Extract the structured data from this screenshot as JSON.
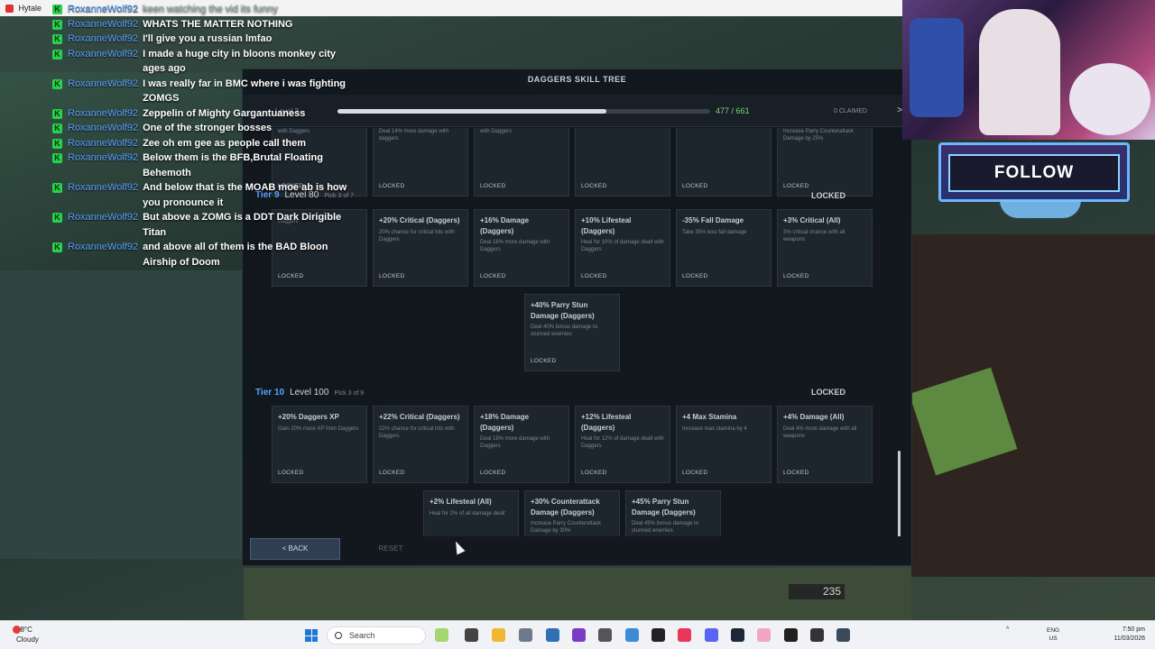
{
  "app_title": "Hytale",
  "chat": [
    {
      "user": "RoxanneWolf92",
      "msg": "keen watching the vid its funny"
    },
    {
      "user": "RoxanneWolf92",
      "msg": "WHATS THE MATTER NOTHING"
    },
    {
      "user": "RoxanneWolf92",
      "msg": "I'll give you a russian lmfao"
    },
    {
      "user": "RoxanneWolf92",
      "msg": "I made a huge city in bloons monkey city ages ago"
    },
    {
      "user": "RoxanneWolf92",
      "msg": "I was really far in BMC where i was fighting ZOMGS"
    },
    {
      "user": "RoxanneWolf92",
      "msg": "Zeppelin of Mighty Gargantuaness"
    },
    {
      "user": "RoxanneWolf92",
      "msg": "One of the stronger bosses"
    },
    {
      "user": "RoxanneWolf92",
      "msg": "Zee oh em gee as people call them"
    },
    {
      "user": "RoxanneWolf92",
      "msg": "Below them is the BFB,Brutal Floating Behemoth"
    },
    {
      "user": "RoxanneWolf92",
      "msg": "And below that is the MOAB moe ab is how you pronounce it"
    },
    {
      "user": "RoxanneWolf92",
      "msg": "But above a ZOMG is a DDT Dark Dirigible Titan"
    },
    {
      "user": "",
      "msg": "and above all of them is the BAD Bloon Airship of Doom"
    }
  ],
  "panel": {
    "title": "DAGGERS SKILL TREE",
    "level": "Level 2",
    "progress_text": "477 / 661",
    "progress_fraction": 0.722,
    "claimed": "0 CLAIMED",
    "next": ">",
    "back": "< BACK",
    "reset": "RESET"
  },
  "top_row": [
    {
      "title": "",
      "desc": "with Daggers",
      "status": "LOCKED"
    },
    {
      "title": "",
      "desc": "Deal 14% more damage with daggers",
      "status": "LOCKED"
    },
    {
      "title": "",
      "desc": "with Daggers",
      "status": "LOCKED"
    },
    {
      "title": "",
      "desc": "",
      "status": "LOCKED"
    },
    {
      "title": "",
      "desc": "",
      "status": "LOCKED"
    },
    {
      "title": "",
      "desc": "Increase Parry Counterattack Damage by 25%",
      "status": "LOCKED"
    }
  ],
  "tier9": {
    "name": "Tier 9",
    "level": "Level 80",
    "pick": "Pick 3 of 7",
    "status": "LOCKED",
    "cards": [
      {
        "title": "",
        "desc": "Daggers",
        "status": "LOCKED"
      },
      {
        "title": "+20% Critical (Daggers)",
        "desc": "20% chance for critical hits with Daggers",
        "status": "LOCKED"
      },
      {
        "title": "+16% Damage (Daggers)",
        "desc": "Deal 16% more damage with Daggers",
        "status": "LOCKED"
      },
      {
        "title": "+10% Lifesteal (Daggers)",
        "desc": "Heal for 10% of damage dealt with Daggers",
        "status": "LOCKED"
      },
      {
        "title": "-35% Fall Damage",
        "desc": "Take 35% less fall damage",
        "status": "LOCKED"
      },
      {
        "title": "+3% Critical (All)",
        "desc": "3% critical chance with all weapons",
        "status": "LOCKED"
      }
    ],
    "extra": {
      "title": "+40% Parry Stun Damage (Daggers)",
      "desc": "Deal 40% bonus damage to stunned enemies",
      "status": "LOCKED"
    }
  },
  "tier10": {
    "name": "Tier 10",
    "level": "Level 100",
    "pick": "Pick 3 of 9",
    "status": "LOCKED",
    "cards": [
      {
        "title": "+20% Daggers XP",
        "desc": "Gain 20% more XP from Daggers",
        "status": "LOCKED"
      },
      {
        "title": "+22% Critical (Daggers)",
        "desc": "22% chance for critical hits with Daggers",
        "status": "LOCKED"
      },
      {
        "title": "+18% Damage (Daggers)",
        "desc": "Deal 18% more damage with Daggers",
        "status": "LOCKED"
      },
      {
        "title": "+12% Lifesteal (Daggers)",
        "desc": "Heal for 12% of damage dealt with Daggers",
        "status": "LOCKED"
      },
      {
        "title": "+4 Max Stamina",
        "desc": "Increase max stamina by 4",
        "status": "LOCKED"
      },
      {
        "title": "+4% Damage (All)",
        "desc": "Deal 4% more damage with all weapons",
        "status": "LOCKED"
      }
    ],
    "extra": [
      {
        "title": "+2% Lifesteal (All)",
        "desc": "Heal for 2% of all damage dealt",
        "status": ""
      },
      {
        "title": "+30% Counterattack Damage (Daggers)",
        "desc": "Increase Parry Counterattack Damage by 30%",
        "status": ""
      },
      {
        "title": "+45% Parry Stun Damage (Daggers)",
        "desc": "Deal 45% bonus damage to stunned enemies",
        "status": ""
      }
    ]
  },
  "overlay": {
    "follow": "FOLLOW",
    "hud_value": "235"
  },
  "taskbar": {
    "temp": "18°C",
    "weather": "Cloudy",
    "search": "Search",
    "lang1": "ENG",
    "lang2": "US",
    "time": "7:50 pm",
    "date": "11/03/2026"
  }
}
